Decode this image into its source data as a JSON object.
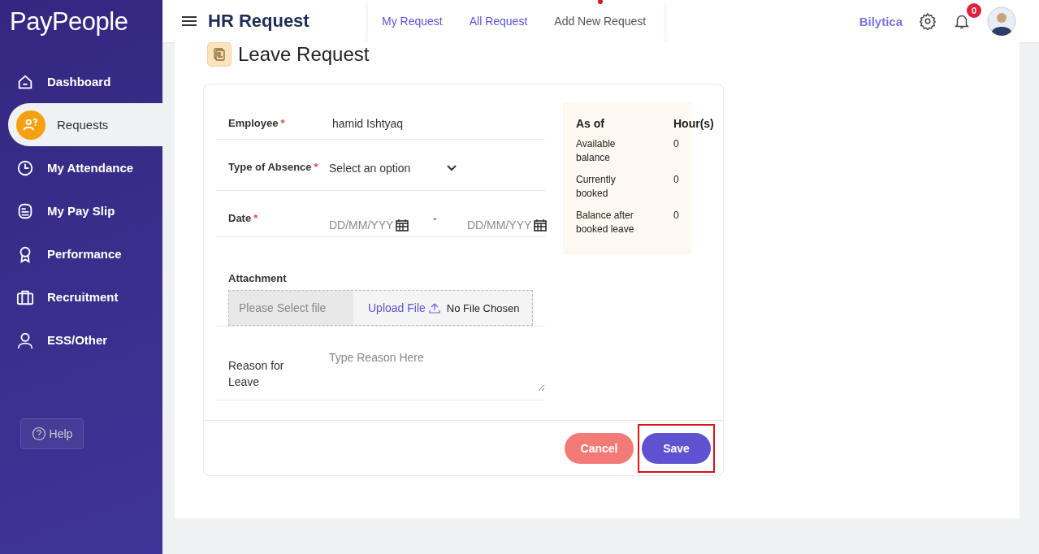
{
  "sidebar": {
    "logo": "PayPeople",
    "items": [
      {
        "label": "Dashboard",
        "selected": false
      },
      {
        "label": "Requests",
        "selected": true
      },
      {
        "label": "My Attendance",
        "selected": false
      },
      {
        "label": "My Pay Slip",
        "selected": false
      },
      {
        "label": "Performance",
        "selected": false
      },
      {
        "label": "Recruitment",
        "selected": false
      },
      {
        "label": "ESS/Other",
        "selected": false
      }
    ],
    "help": "Help"
  },
  "header": {
    "title": "HR Request",
    "tabs": [
      {
        "label": "My Request",
        "selected": false
      },
      {
        "label": "All Request",
        "selected": false
      },
      {
        "label": "Add New Request",
        "selected": true
      }
    ],
    "company": "Bilytica",
    "notifications": "0"
  },
  "page": {
    "title": "Leave Request"
  },
  "form": {
    "fields": [
      {
        "kind": "text",
        "label": "Employee",
        "required_mark": "*",
        "value": "hamid Ishtyaq"
      },
      {
        "kind": "select",
        "label": "Type of Absence",
        "required_mark": "*",
        "value": "Select an option"
      },
      {
        "kind": "daterange",
        "label": "Date",
        "required_mark": "*",
        "from_placeholder": "DD/MM/YYY",
        "separator": "-",
        "to_placeholder": "DD/MM/YYY"
      },
      {
        "kind": "file",
        "label": "Attachment",
        "placeholder": "Please Select file",
        "button": "Upload File",
        "status": "No File Chosen"
      },
      {
        "kind": "textarea",
        "label": "Reason for Leave",
        "placeholder": "Type Reason Here"
      }
    ],
    "balance": {
      "heading": "As of",
      "unit_heading": "Hour(s)",
      "rows": [
        {
          "label": "Available balance",
          "value": "0"
        },
        {
          "label": "Currently booked",
          "value": "0"
        },
        {
          "label": "Balance after booked leave",
          "value": "0"
        }
      ]
    },
    "buttons": [
      {
        "kind": "cancel",
        "label": "Cancel",
        "highlighted": false
      },
      {
        "kind": "save",
        "label": "Save",
        "highlighted": true
      }
    ]
  }
}
